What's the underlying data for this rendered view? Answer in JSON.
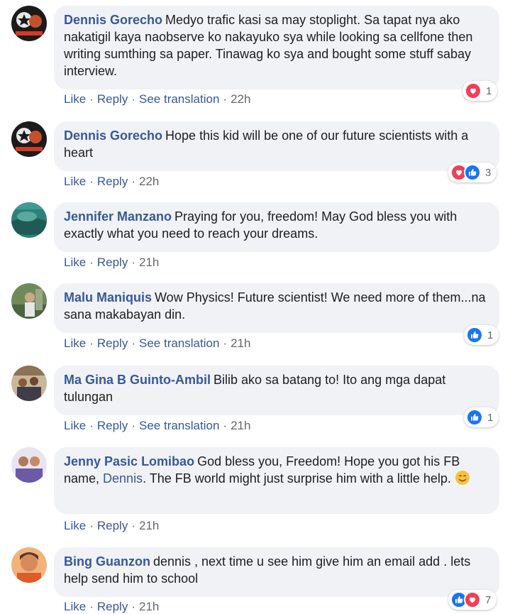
{
  "comments": [
    {
      "author": "Dennis Gorecho",
      "text": "Medyo trafic kasi sa may stoplight. Sa tapat nya ako nakatigil kaya naobserve ko nakayuko sya while looking sa cellfone then writing sumthing sa paper. Tinawag ko sya and bought some stuff sabay interview.",
      "like": "Like",
      "reply": "Reply",
      "translate": "See translation",
      "time": "22h",
      "reaction_count": "1"
    },
    {
      "author": "Dennis Gorecho",
      "text": "Hope this kid will be one of our future scientists with a heart",
      "like": "Like",
      "reply": "Reply",
      "time": "22h",
      "reaction_count": "3"
    },
    {
      "author": "Jennifer Manzano",
      "text": "Praying for you, freedom! May God bless you with exactly what you need to reach your dreams.",
      "like": "Like",
      "reply": "Reply",
      "time": "21h"
    },
    {
      "author": "Malu Maniquis",
      "text": "Wow Physics! Future scientist! We need more of them...na sana makabayan din.",
      "like": "Like",
      "reply": "Reply",
      "translate": "See translation",
      "time": "21h",
      "reaction_count": "1"
    },
    {
      "author": "Ma Gina B Guinto-Ambil",
      "text": "Bilib ako sa batang to! Ito ang mga dapat tulungan",
      "like": "Like",
      "reply": "Reply",
      "translate": "See translation",
      "time": "21h",
      "reaction_count": "1"
    },
    {
      "author": "Jenny Pasic Lomibao",
      "text_before": "God bless you, Freedom! Hope you got his FB name, ",
      "mention": "Dennis",
      "text_after": ". The FB world might just surprise him with a little help.",
      "like": "Like",
      "reply": "Reply",
      "time": "21h"
    },
    {
      "author": "Bing Guanzon",
      "text": "dennis , next time u see him give him an email add . lets help send him to school",
      "like": "Like",
      "reply": "Reply",
      "time": "21h",
      "reaction_count": "7"
    }
  ],
  "separator": "·",
  "colors": {
    "name": "#385898",
    "bubble": "#f0f2f5",
    "love": "#f33e58",
    "like": "#1877f2"
  },
  "icons": {
    "love": "heart-icon",
    "like": "thumbs-up-icon",
    "smile": "smiling-face-emoji"
  }
}
